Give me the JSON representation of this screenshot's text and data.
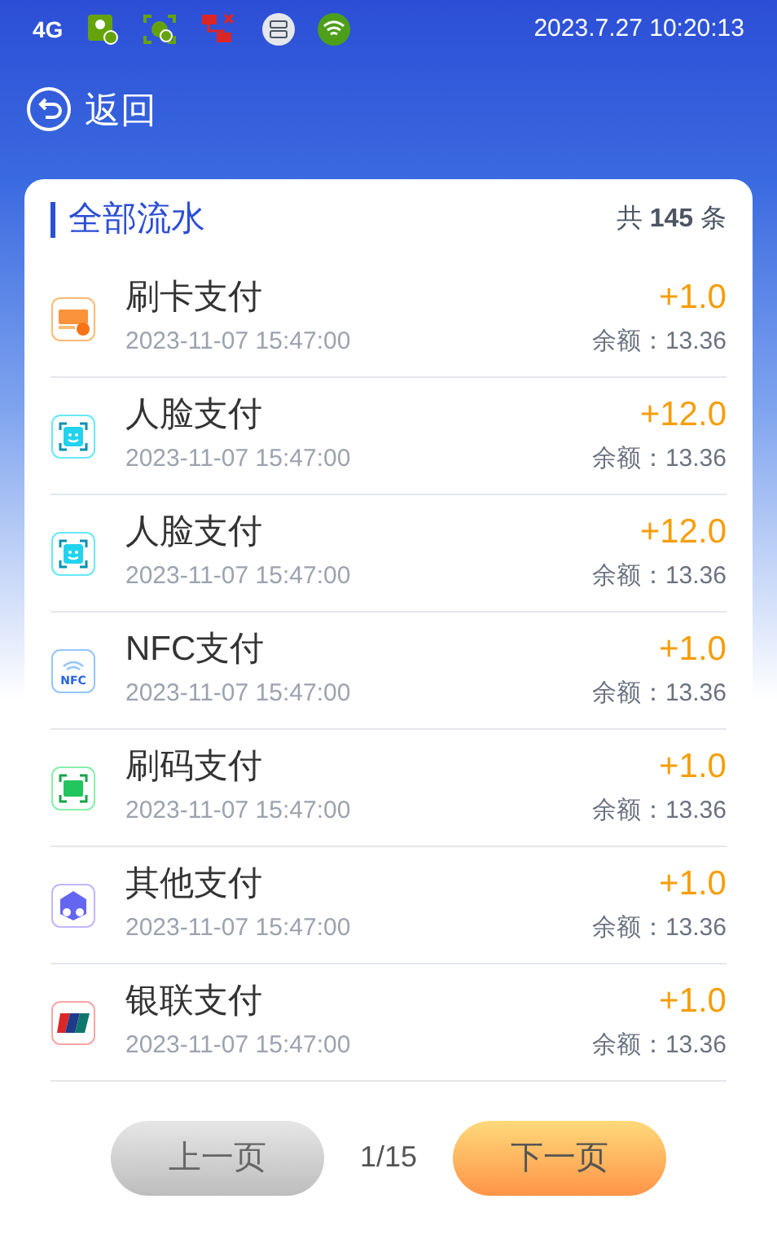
{
  "status_bar": {
    "network": "4G",
    "time": "2023.7.27 10:20:13"
  },
  "header": {
    "back_label": "返回"
  },
  "card": {
    "title": "全部流水",
    "count_prefix": "共",
    "count": "145",
    "count_suffix": "条"
  },
  "records": [
    {
      "kind": "card",
      "name": "刷卡支付",
      "time": "2023-11-07 15:47:00",
      "amount": "+1.0",
      "balance": "余额：13.36"
    },
    {
      "kind": "face",
      "name": "人脸支付",
      "time": "2023-11-07 15:47:00",
      "amount": "+12.0",
      "balance": "余额：13.36"
    },
    {
      "kind": "face",
      "name": "人脸支付",
      "time": "2023-11-07 15:47:00",
      "amount": "+12.0",
      "balance": "余额：13.36"
    },
    {
      "kind": "nfc",
      "name": "NFC支付",
      "time": "2023-11-07 15:47:00",
      "amount": "+1.0",
      "balance": "余额：13.36",
      "icon_text": "NFC"
    },
    {
      "kind": "qr",
      "name": "刷码支付",
      "time": "2023-11-07 15:47:00",
      "amount": "+1.0",
      "balance": "余额：13.36"
    },
    {
      "kind": "other",
      "name": "其他支付",
      "time": "2023-11-07 15:47:00",
      "amount": "+1.0",
      "balance": "余额：13.36"
    },
    {
      "kind": "unionpay",
      "name": "银联支付",
      "time": "2023-11-07 15:47:00",
      "amount": "+1.0",
      "balance": "余额：13.36"
    }
  ],
  "pager": {
    "prev": {
      "label": "上一页",
      "disabled": true
    },
    "page": "1/15",
    "next": {
      "label": "下一页",
      "disabled": false
    }
  }
}
